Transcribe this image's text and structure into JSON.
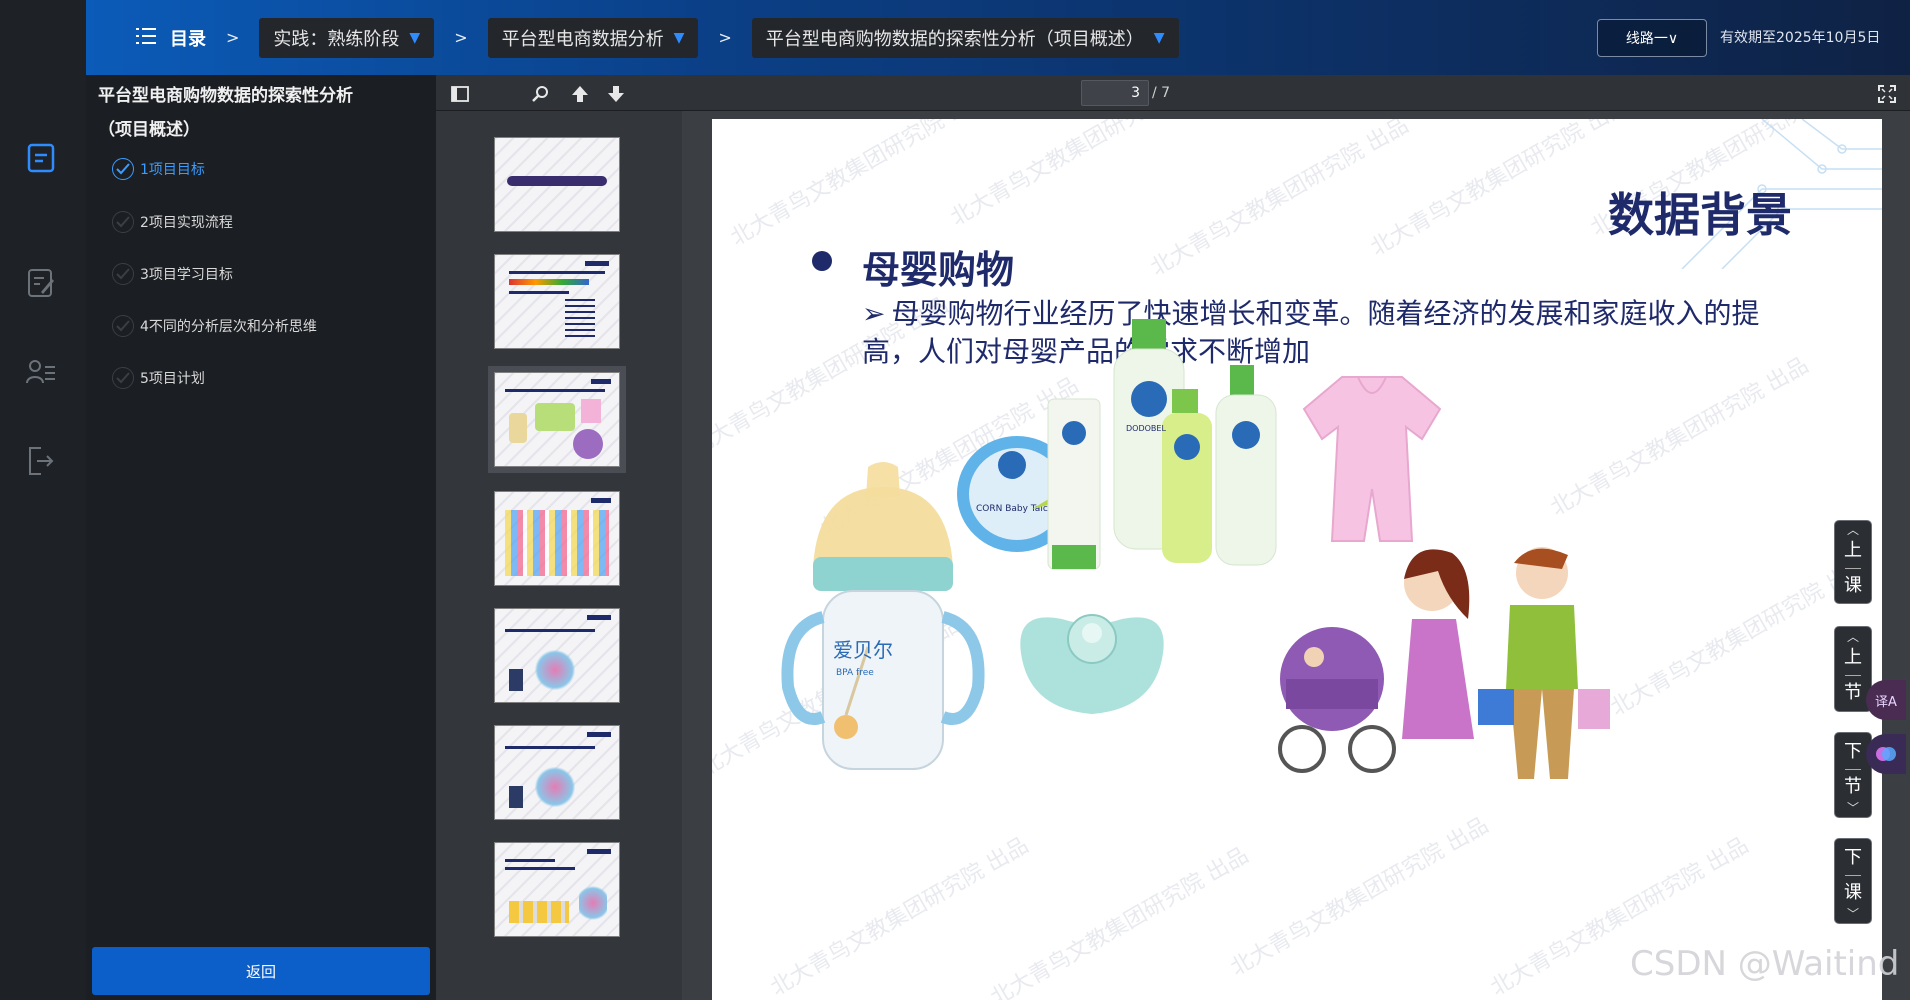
{
  "header": {
    "toc_label": "目录",
    "sep": ">",
    "crumbs": [
      "实践：熟练阶段",
      "平台型电商数据分析",
      "平台型电商购物数据的探索性分析（项目概述）"
    ],
    "route_btn": "线路一∨",
    "expiry": "有效期至2025年10月5日"
  },
  "toc": {
    "title": "平台型电商购物数据的探索性分析（项目概述）",
    "items": [
      {
        "label": "1项目目标",
        "active": true
      },
      {
        "label": "2项目实现流程",
        "active": false
      },
      {
        "label": "3项目学习目标",
        "active": false
      },
      {
        "label": "4不同的分析层次和分析思维",
        "active": false
      },
      {
        "label": "5项目计划",
        "active": false
      }
    ],
    "back_label": "返回"
  },
  "pdf": {
    "page_current": "3",
    "page_total": "/ 7",
    "thumb_count": 7,
    "selected_thumb": 3
  },
  "slide": {
    "heading": "数据背景",
    "subheading": "母婴购物",
    "arrow": "➢",
    "body": "母婴购物行业经历了快速增长和变革。随着经济的发展和家庭收入的提高，人们对母婴产品的需求不断增加",
    "watermark": "北大青鸟文教集团研究院 出品",
    "product_labels": [
      "爱贝尔",
      "BPA free",
      "DODOBEL",
      "CORN Baby Talcum Powder"
    ]
  },
  "side_controls": {
    "prev_lesson": [
      "上",
      "课"
    ],
    "prev_section": [
      "上",
      "节"
    ],
    "next_section": [
      "下",
      "节"
    ],
    "next_lesson": [
      "下",
      "课"
    ]
  },
  "float_tools": [
    "译A",
    "脑"
  ],
  "credit": "CSDN @Waitind",
  "colors": {
    "accent": "#0c5ec8",
    "active_link": "#3b9cff",
    "slide_text": "#1f2a6b"
  }
}
